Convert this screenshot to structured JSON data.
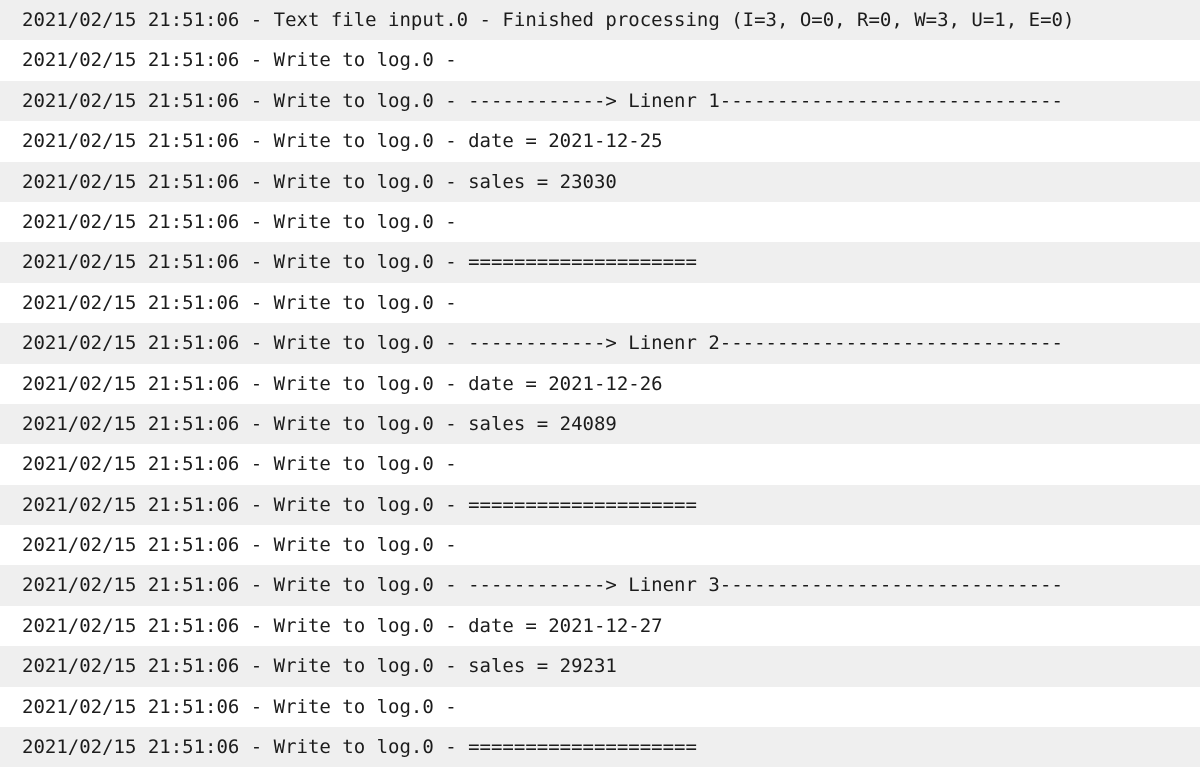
{
  "log": {
    "lines": [
      "2021/02/15 21:51:06 - Text file input.0 - Finished processing (I=3, O=0, R=0, W=3, U=1, E=0)",
      "2021/02/15 21:51:06 - Write to log.0 -",
      "2021/02/15 21:51:06 - Write to log.0 - ------------> Linenr 1------------------------------",
      "2021/02/15 21:51:06 - Write to log.0 - date = 2021-12-25",
      "2021/02/15 21:51:06 - Write to log.0 - sales = 23030",
      "2021/02/15 21:51:06 - Write to log.0 -",
      "2021/02/15 21:51:06 - Write to log.0 - ====================",
      "2021/02/15 21:51:06 - Write to log.0 -",
      "2021/02/15 21:51:06 - Write to log.0 - ------------> Linenr 2------------------------------",
      "2021/02/15 21:51:06 - Write to log.0 - date = 2021-12-26",
      "2021/02/15 21:51:06 - Write to log.0 - sales = 24089",
      "2021/02/15 21:51:06 - Write to log.0 -",
      "2021/02/15 21:51:06 - Write to log.0 - ====================",
      "2021/02/15 21:51:06 - Write to log.0 -",
      "2021/02/15 21:51:06 - Write to log.0 - ------------> Linenr 3------------------------------",
      "2021/02/15 21:51:06 - Write to log.0 - date = 2021-12-27",
      "2021/02/15 21:51:06 - Write to log.0 - sales = 29231",
      "2021/02/15 21:51:06 - Write to log.0 -",
      "2021/02/15 21:51:06 - Write to log.0 - ===================="
    ]
  }
}
